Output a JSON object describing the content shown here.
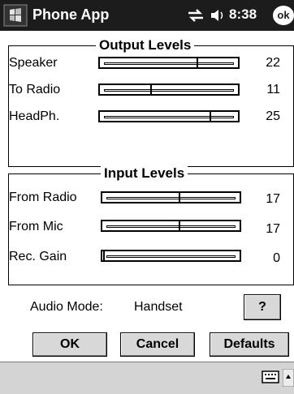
{
  "titlebar": {
    "app_title": "Phone App",
    "clock": "8:38",
    "ok_label": "ok"
  },
  "output": {
    "title": "Output Levels",
    "rows": [
      {
        "label": "Speaker",
        "value": "22"
      },
      {
        "label": "To Radio",
        "value": "11"
      },
      {
        "label": "HeadPh.",
        "value": "25"
      }
    ]
  },
  "input": {
    "title": "Input Levels",
    "rows": [
      {
        "label": "From Radio",
        "value": "17"
      },
      {
        "label": "From Mic",
        "value": "17"
      },
      {
        "label": "Rec. Gain",
        "value": "0"
      }
    ]
  },
  "audio_mode": {
    "label": "Audio Mode:",
    "value": "Handset",
    "help_label": "?"
  },
  "buttons": {
    "ok": "OK",
    "cancel": "Cancel",
    "defaults": "Defaults"
  },
  "icons": [
    "windows-start-icon",
    "connectivity-icon",
    "speaker-volume-icon",
    "keyboard-icon",
    "sip-arrow-icon"
  ]
}
